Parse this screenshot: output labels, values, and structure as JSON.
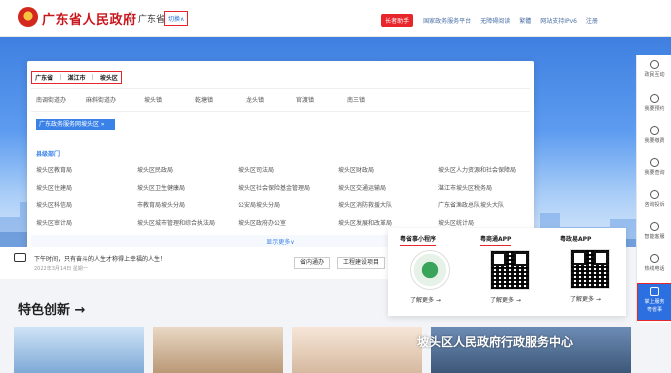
{
  "header": {
    "site_title": "广东省人民政府",
    "province": "广东省",
    "switch_label": "切换∧",
    "elder_label": "长者助手",
    "nav": [
      "国家政务服务平台",
      "无障碍阅读",
      "繁體",
      "网站支持IPv6",
      "注册"
    ]
  },
  "dropdown": {
    "regions": [
      "广东省",
      "湛江市",
      "坡头区"
    ],
    "towns": [
      "南调街道办",
      "麻斜街道办",
      "坡头镇",
      "乾塘镇",
      "龙头镇",
      "官渡镇",
      "南三镇"
    ],
    "service_hall_label": "广东政务服务网坡头区 »",
    "section_title": "县级部门",
    "departments": [
      [
        "坡头区教育局",
        "坡头区民政局",
        "坡头区司法局",
        "坡头区财政局",
        "坡头区人力资源和社会保障局"
      ],
      [
        "坡头区住建局",
        "坡头区卫生健康局",
        "坡头区社会保险基金管理局",
        "坡头区交通运输局",
        "湛江市坡头区税务局"
      ],
      [
        "坡头区科信局",
        "市教育局坡头分局",
        "公安局坡头分局",
        "坡头区消防救援大队",
        "广东省渔政总队坡头大队"
      ],
      [
        "坡头区审计局",
        "坡头区城市管理和综合执法局",
        "坡头区政府办公室",
        "坡头区发展和改革局",
        "坡头区统计局"
      ]
    ],
    "show_more": "显示更多∨"
  },
  "greeting": {
    "text": "下午时间，只有奋斗的人生才称得上幸福的人生！",
    "date": "2022年3月14日 星期一",
    "buttons": [
      "省内通办",
      "工程建设项目"
    ]
  },
  "apps": [
    {
      "name": "粤省事小程序",
      "learn_more": "了解更多 →"
    },
    {
      "name": "粤商通APP",
      "learn_more": "了解更多 →"
    },
    {
      "name": "粤政易APP",
      "learn_more": "了解更多 →"
    }
  ],
  "sidebar": {
    "items": [
      "政民互动",
      "我要预约",
      "我要缴费",
      "我要查询",
      "咨询投诉",
      "智能客服",
      "热线电话",
      "掌上服务"
    ],
    "active_extra": "粤省事"
  },
  "feature": {
    "title": "特色创新 →"
  },
  "watermark": "坡头区人民政府行政服务中心"
}
